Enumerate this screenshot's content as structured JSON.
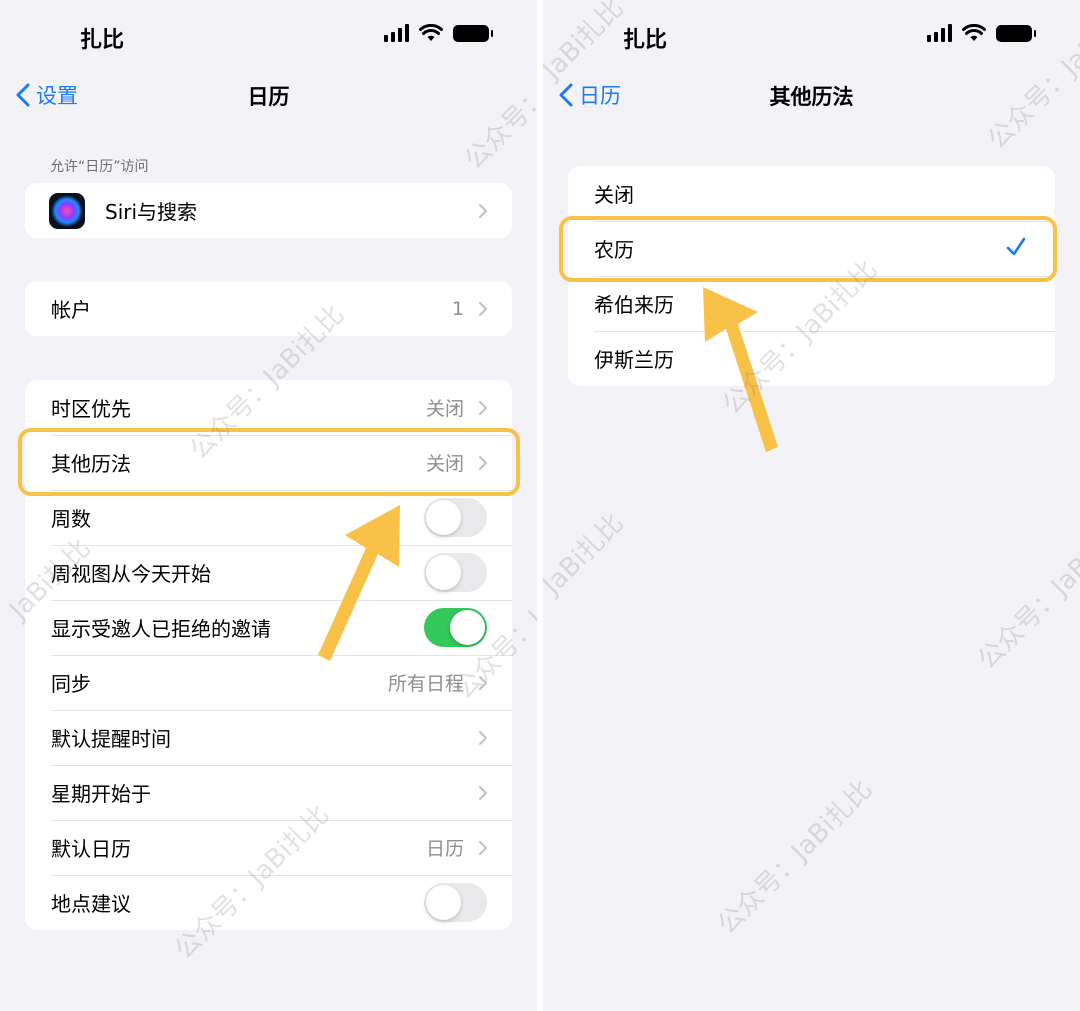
{
  "left": {
    "status": {
      "carrier": "扎比"
    },
    "nav": {
      "back_label": "设置",
      "title": "日历"
    },
    "section_header": "允许“日历”访问",
    "siri_row": {
      "label": "Siri与搜索"
    },
    "accounts_row": {
      "label": "帐户",
      "value": "1"
    },
    "settings": {
      "timezone": {
        "label": "时区优先",
        "value": "关闭"
      },
      "alt_calendars": {
        "label": "其他历法",
        "value": "关闭"
      },
      "week_numbers": {
        "label": "周数",
        "toggle_on": false
      },
      "week_view_today": {
        "label": "周视图从今天开始",
        "toggle_on": false
      },
      "show_declined": {
        "label": "显示受邀人已拒绝的邀请",
        "toggle_on": true
      },
      "sync": {
        "label": "同步",
        "value": "所有日程"
      },
      "default_alert": {
        "label": "默认提醒时间"
      },
      "week_start": {
        "label": "星期开始于"
      },
      "default_calendar": {
        "label": "默认日历",
        "value": "日历"
      },
      "location_suggest": {
        "label": "地点建议",
        "toggle_on": false
      }
    }
  },
  "right": {
    "status": {
      "carrier": "扎比"
    },
    "nav": {
      "back_label": "日历",
      "title": "其他历法"
    },
    "options": [
      {
        "label": "关闭",
        "selected": false
      },
      {
        "label": "农历",
        "selected": true
      },
      {
        "label": "希伯来历",
        "selected": false
      },
      {
        "label": "伊斯兰历",
        "selected": false
      }
    ]
  },
  "watermarks": {
    "handle": "公众号：JaBi扎比",
    "brand": "JaBi扎比"
  },
  "colors": {
    "accent": "#1a7cf5",
    "highlight": "#f8c249",
    "toggle_on": "#34c759",
    "background": "#f2f2f7"
  },
  "icons": {
    "back": "chevron-left-icon",
    "disclosure": "chevron-right-icon",
    "check": "checkmark-icon",
    "siri": "siri-icon"
  }
}
